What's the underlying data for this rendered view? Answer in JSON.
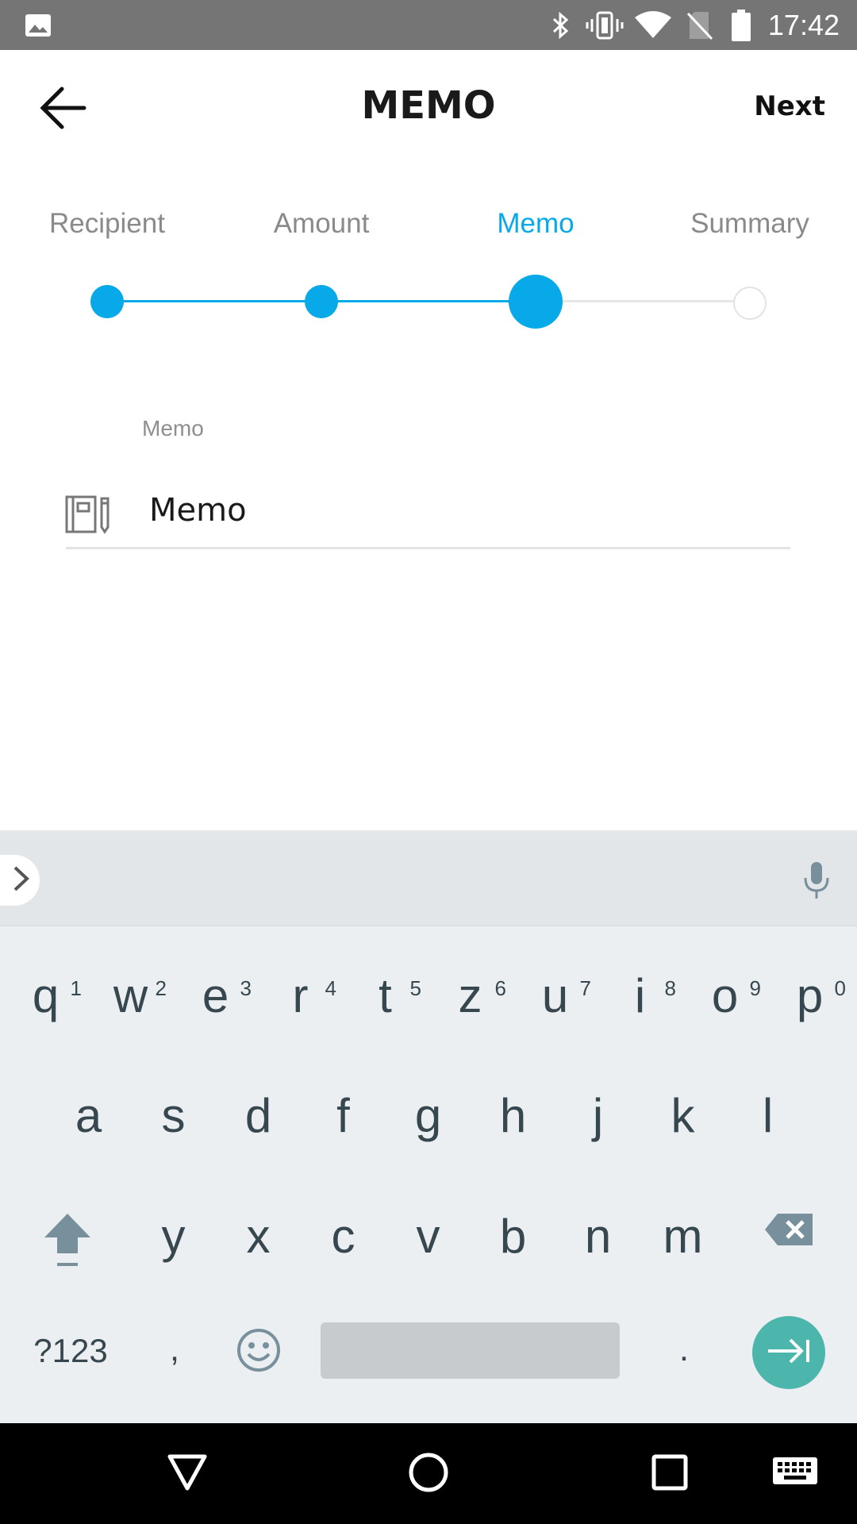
{
  "status_bar": {
    "time": "17:42",
    "icons": [
      "image-icon",
      "bluetooth-icon",
      "vibrate-icon",
      "wifi-icon",
      "no-sim-icon",
      "battery-icon"
    ]
  },
  "app_bar": {
    "title": "MEMO",
    "next_label": "Next",
    "back_icon": "arrow-left-icon"
  },
  "stepper": {
    "steps": [
      {
        "label": "Recipient",
        "state": "done"
      },
      {
        "label": "Amount",
        "state": "done"
      },
      {
        "label": "Memo",
        "state": "active"
      },
      {
        "label": "Summary",
        "state": "pending"
      }
    ],
    "accent_color": "#08a9e8"
  },
  "memo_field": {
    "label": "Memo",
    "placeholder": "Memo",
    "icon": "notebook-pencil-icon"
  },
  "keyboard": {
    "row1": [
      {
        "key": "q",
        "hint": "1"
      },
      {
        "key": "w",
        "hint": "2"
      },
      {
        "key": "e",
        "hint": "3"
      },
      {
        "key": "r",
        "hint": "4"
      },
      {
        "key": "t",
        "hint": "5"
      },
      {
        "key": "z",
        "hint": "6"
      },
      {
        "key": "u",
        "hint": "7"
      },
      {
        "key": "i",
        "hint": "8"
      },
      {
        "key": "o",
        "hint": "9"
      },
      {
        "key": "p",
        "hint": "0"
      }
    ],
    "row2": [
      "a",
      "s",
      "d",
      "f",
      "g",
      "h",
      "j",
      "k",
      "l"
    ],
    "row3": [
      "y",
      "x",
      "c",
      "v",
      "b",
      "n",
      "m"
    ],
    "symbols_label": "?123",
    "comma_label": ",",
    "period_label": ".",
    "enter_color": "#4db6ac"
  },
  "nav_bar": {
    "icons": [
      "back-triangle-icon",
      "home-circle-icon",
      "recents-square-icon",
      "keyboard-icon"
    ]
  }
}
